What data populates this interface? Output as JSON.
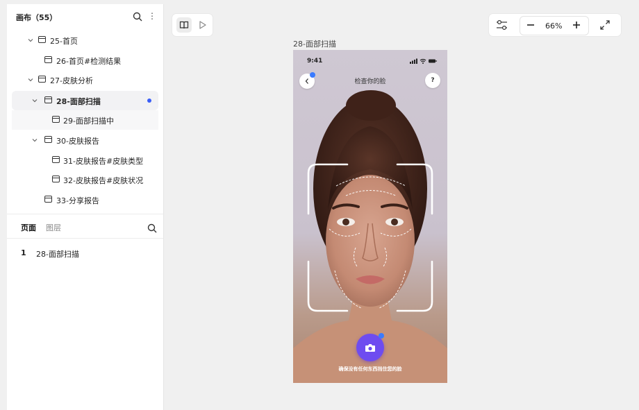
{
  "sidebar": {
    "title": "画布（55）",
    "tree": [
      {
        "label": "25-首页",
        "level": 1,
        "expanded": true
      },
      {
        "label": "26-首页#检测结果",
        "level": 2
      },
      {
        "label": "27-皮肤分析",
        "level": 1,
        "expanded": true
      },
      {
        "label": "28-面部扫描",
        "level": 1,
        "expanded": true,
        "selected": true
      },
      {
        "label": "29-面部扫描中",
        "level": 2
      },
      {
        "label": "30-皮肤报告",
        "level": 1,
        "expanded": true
      },
      {
        "label": "31-皮肤报告#皮肤类型",
        "level": 2
      },
      {
        "label": "32-皮肤报告#皮肤状况",
        "level": 2
      },
      {
        "label": "33-分享报告",
        "level": 1
      }
    ],
    "tabs": {
      "pages": "页面",
      "layers": "图层"
    },
    "pages": [
      {
        "num": "1",
        "name": "28-面部扫描"
      }
    ]
  },
  "toolbar": {
    "zoom": "66%"
  },
  "artboard": {
    "name": "28-面部扫描",
    "status_time": "9:41",
    "nav_title": "检查你的脸",
    "help_label": "?",
    "hint": "确保没有任何东西挡住您的脸"
  },
  "colors": {
    "accent": "#3a5ef7",
    "shutter": "#6e4cf0"
  }
}
